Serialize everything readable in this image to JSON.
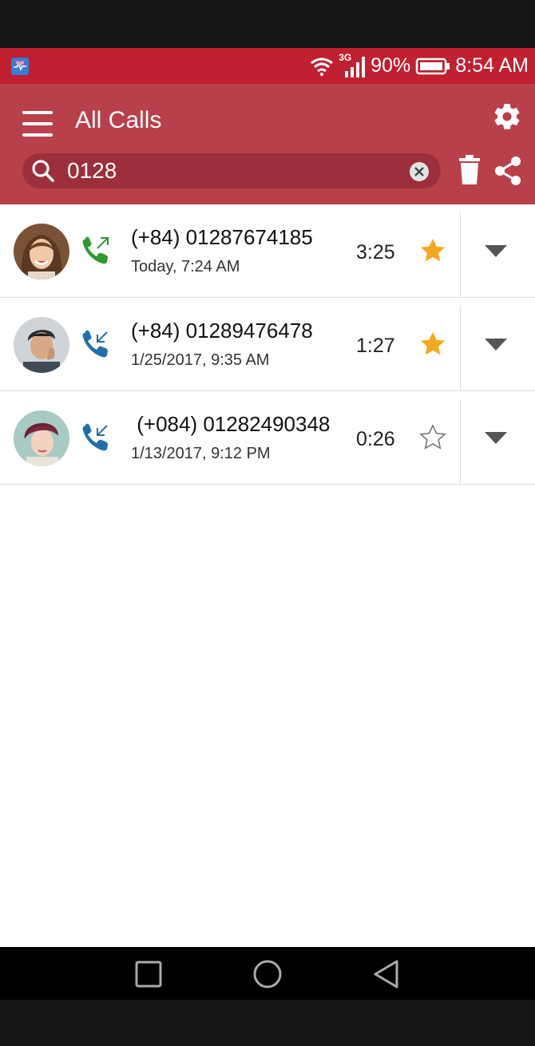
{
  "status_bar": {
    "network": "3G",
    "battery": "90%",
    "time": "8:54 AM"
  },
  "app_bar": {
    "title": "All Calls"
  },
  "search": {
    "value": "0128"
  },
  "calls": [
    {
      "number": "(+84) 01287674185",
      "datetime": "Today, 7:24 AM",
      "duration": "3:25",
      "direction": "outgoing",
      "starred": true
    },
    {
      "number": "(+84) 01289476478",
      "datetime": "1/25/2017, 9:35 AM",
      "duration": "1:27",
      "direction": "incoming",
      "starred": true
    },
    {
      "number": " (+084) 01282490348",
      "datetime": "1/13/2017, 9:12 PM",
      "duration": "0:26",
      "direction": "incoming",
      "starred": false
    }
  ],
  "colors": {
    "status_bar": "#c0202f",
    "app_bar": "#b8404b",
    "search_bg": "#9c2f3b",
    "outgoing": "#2e9a2e",
    "incoming": "#1f6ea8",
    "star": "#f4a81d"
  }
}
